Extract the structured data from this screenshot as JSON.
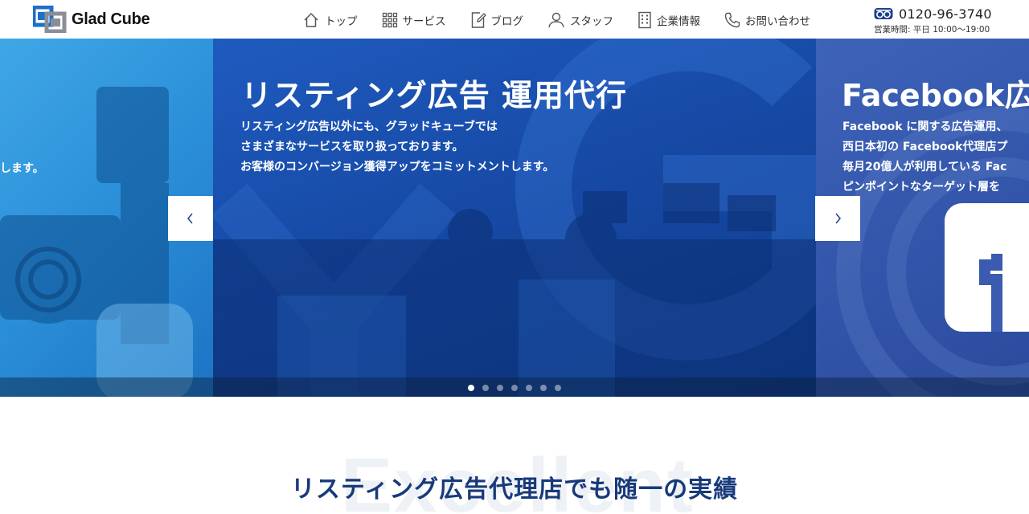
{
  "header": {
    "logo_text": "Glad Cube",
    "nav": [
      {
        "label": "トップ",
        "icon": "home-icon"
      },
      {
        "label": "サービス",
        "icon": "grid-icon"
      },
      {
        "label": "ブログ",
        "icon": "edit-icon"
      },
      {
        "label": "スタッフ",
        "icon": "user-icon"
      },
      {
        "label": "企業情報",
        "icon": "building-icon"
      },
      {
        "label": "お問い合わせ",
        "icon": "phone-icon"
      }
    ],
    "phone": {
      "icon": "freedial-icon",
      "number": "0120-96-3740",
      "hours": "営業時間: 平日 10:00〜19:00"
    }
  },
  "slider": {
    "left_slide": {
      "text": "します。"
    },
    "main_slide": {
      "title": "リスティング広告 運用代行",
      "desc_lines": [
        "リスティング広告以外にも、グラッドキューブでは",
        "さまざまなサービスを取り扱っております。",
        "お客様のコンバージョン獲得アップをコミットメントします。"
      ]
    },
    "right_slide": {
      "title": "Facebook広",
      "desc_lines": [
        "Facebook に関する広告運用、",
        "西日本初の Facebook代理店プ",
        "毎月20億人が利用している Fac",
        "ピンポイントなターゲット層を"
      ]
    },
    "dots_count": 7,
    "active_dot": 0
  },
  "section": {
    "bg_word": "Excellent",
    "title": "リスティング広告代理店でも随一の実績"
  },
  "colors": {
    "brand_blue": "#1e6fc8",
    "title_navy": "#183a7a"
  }
}
